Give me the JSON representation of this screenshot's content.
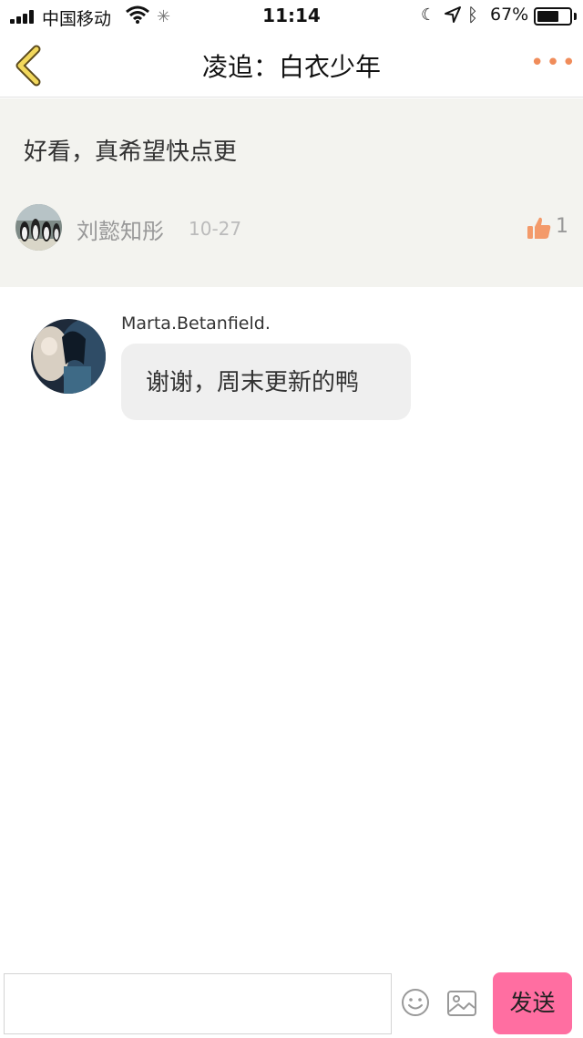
{
  "status_bar": {
    "carrier": "中国移动",
    "time": "11:14",
    "battery": "67%",
    "battery_level": 0.67
  },
  "nav": {
    "title": "凌追：白衣少年",
    "more": "•••",
    "accent_color": "#f08c5a"
  },
  "comment": {
    "text": "好看，真希望快点更",
    "author": "刘懿知彤",
    "date": "10-27",
    "likes": "1"
  },
  "reply": {
    "author": "Marta.Betanfield.",
    "message": "谢谢，周末更新的鸭"
  },
  "input_bar": {
    "placeholder": "",
    "send_label": "发送",
    "send_color": "#ff6ea1"
  }
}
